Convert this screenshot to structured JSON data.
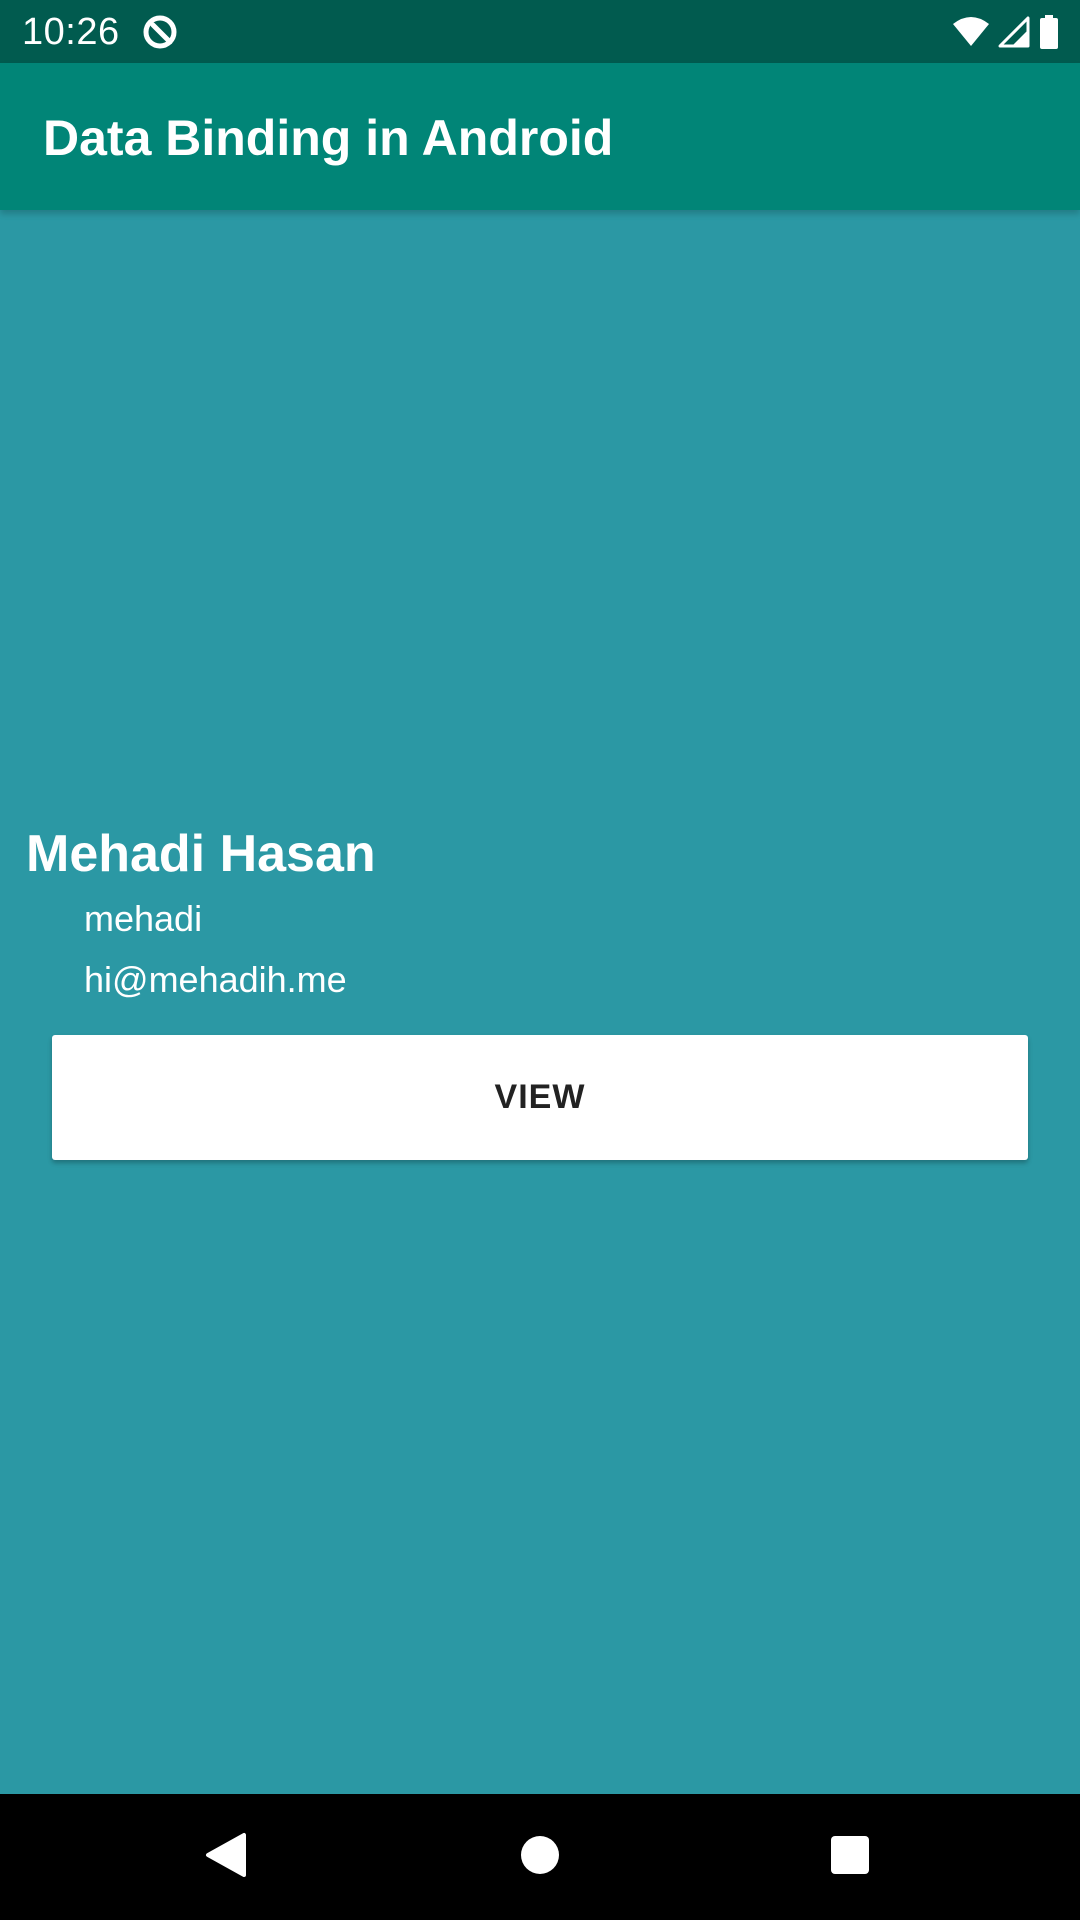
{
  "status_bar": {
    "time": "10:26",
    "icons": [
      "notification-q-icon",
      "wifi-icon",
      "signal-icon",
      "battery-icon"
    ]
  },
  "app_bar": {
    "title": "Data Binding in Android"
  },
  "user": {
    "name": "Mehadi Hasan",
    "username": "mehadi",
    "email": "hi@mehadih.me"
  },
  "actions": {
    "view_label": "VIEW"
  },
  "navigation": {
    "buttons": [
      "back-icon",
      "home-icon",
      "recents-icon"
    ]
  },
  "colors": {
    "status_bar": "#015b4f",
    "app_bar": "#018577",
    "background": "#2b98a4",
    "button": "#ffffff",
    "nav_bar": "#000000"
  }
}
